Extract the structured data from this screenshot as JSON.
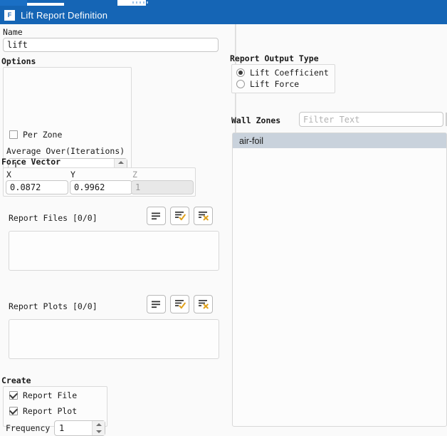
{
  "window": {
    "title": "Lift Report Definition",
    "icon": "fluent-app-icon",
    "titlebar_color": "#1565b5"
  },
  "name_field": {
    "label": "Name",
    "value": "lift",
    "placeholder": ""
  },
  "options": {
    "label": "Options",
    "per_zone": {
      "label": "Per Zone",
      "checked": false
    },
    "average_over": {
      "label": "Average Over(Iterations)",
      "value": "1"
    }
  },
  "force_vector": {
    "label": "Force Vector",
    "fields": [
      {
        "label": "X",
        "value": "0.0872",
        "disabled": false
      },
      {
        "label": "Y",
        "value": "0.9962",
        "disabled": false
      },
      {
        "label": "Z",
        "value": "1",
        "disabled": true
      }
    ]
  },
  "report_files": {
    "label": "Report Files [0/0]",
    "buttons": [
      {
        "name": "new-report-file-button",
        "icon": "list-lines-icon"
      },
      {
        "name": "edit-report-file-button",
        "icon": "list-check-icon"
      },
      {
        "name": "delete-report-file-button",
        "icon": "list-x-icon"
      }
    ],
    "items": []
  },
  "report_plots": {
    "label": "Report Plots [0/0]",
    "buttons": [
      {
        "name": "new-report-plot-button",
        "icon": "list-lines-icon"
      },
      {
        "name": "edit-report-plot-button",
        "icon": "list-check-icon"
      },
      {
        "name": "delete-report-plot-button",
        "icon": "list-x-icon"
      }
    ],
    "items": []
  },
  "create": {
    "label": "Create",
    "report_file": {
      "label": "Report File",
      "checked": true
    },
    "report_plot": {
      "label": "Report Plot",
      "checked": true
    },
    "frequency": {
      "label": "Frequency",
      "value": "1"
    }
  },
  "report_output_type": {
    "label": "Report Output Type",
    "options": [
      {
        "label": "Lift Coefficient",
        "selected": true
      },
      {
        "label": "Lift Force",
        "selected": false
      }
    ]
  },
  "wall_zones": {
    "label": "Wall Zones",
    "filter_placeholder": "Filter Text",
    "filter_value": "",
    "items": [
      {
        "label": "air-foil",
        "selected": true
      }
    ]
  },
  "colors": {
    "accent": "#1565b5",
    "selection": "#c9d2dc",
    "icon_gold": "#e0a11b"
  }
}
